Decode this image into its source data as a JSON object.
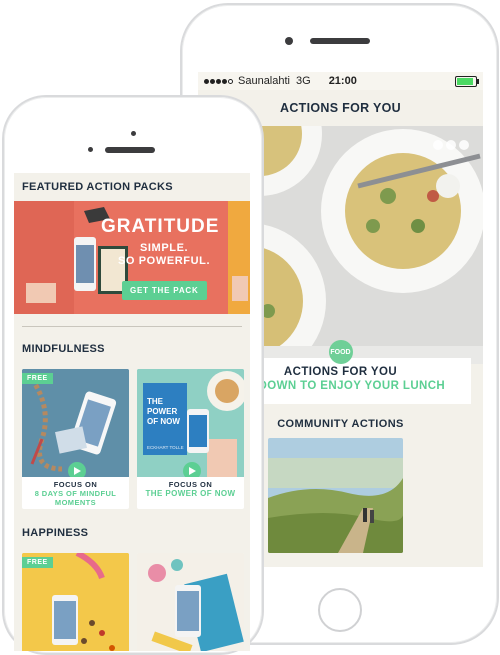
{
  "back_phone": {
    "status": {
      "carrier": "Saunalahti",
      "network": "3G",
      "time": "21:00"
    },
    "title": "ACTIONS FOR YOU",
    "hero_card": {
      "badge": "FOOD",
      "title": "ACTIONS FOR YOU",
      "subtitle": "SIT DOWN TO ENJOY YOUR LUNCH"
    },
    "community": {
      "heading": "COMMUNITY ACTIONS"
    }
  },
  "front_phone": {
    "featured": {
      "heading": "FEATURED ACTION PACKS",
      "banner_title": "GRATITUDE",
      "banner_line1": "SIMPLE.",
      "banner_line2": "SO POWERFUL.",
      "button": "GET THE PACK"
    },
    "mindfulness": {
      "heading": "MINDFULNESS",
      "cards": [
        {
          "free": "FREE",
          "focus": "FOCUS ON",
          "name": "8 DAYS OF MINDFUL MOMENTS"
        },
        {
          "focus": "FOCUS ON",
          "name": "THE POWER OF NOW",
          "book_title": "THE POWER OF NOW",
          "book_author": "ECKHART TOLLE"
        }
      ]
    },
    "happiness": {
      "heading": "HAPPINESS",
      "free": "FREE"
    }
  },
  "colors": {
    "accent_green": "#5ccf93",
    "navy": "#1f2e3f",
    "coral": "#e8715f",
    "screen_bg": "#f3f1ea"
  }
}
